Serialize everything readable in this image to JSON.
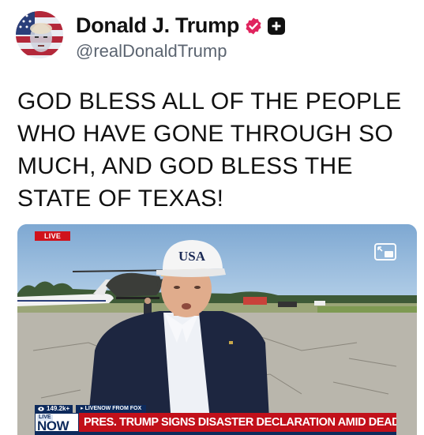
{
  "author": {
    "display_name": "Donald J. Trump",
    "handle": "@realDonaldTrump",
    "avatar_icon": "profile-avatar-flag",
    "verified_icon": "verified-badge-icon",
    "verified_color": "#e0245e",
    "subscription_icon": "plus-badge-icon"
  },
  "post": {
    "text": "GOD BLESS ALL OF THE PEOPLE WHO HAVE GONE THROUGH SO MUCH, AND GOD BLESS THE STATE OF TEXAS!"
  },
  "video": {
    "live_label": "LIVE",
    "expand_icon": "picture-in-picture-icon",
    "cap_text": "USA",
    "lower_third": {
      "viewer_count": "149.2k+",
      "source_label": "LIVENOW FROM FOX",
      "now_live": "LIVE",
      "now_word": "NOW",
      "headline": "PRES. TRUMP SIGNS DISASTER DECLARATION AMID DEADLY TEXAS FLOODS",
      "headline_color": "#c2101a",
      "brand_color": "#0d2a5c"
    }
  }
}
